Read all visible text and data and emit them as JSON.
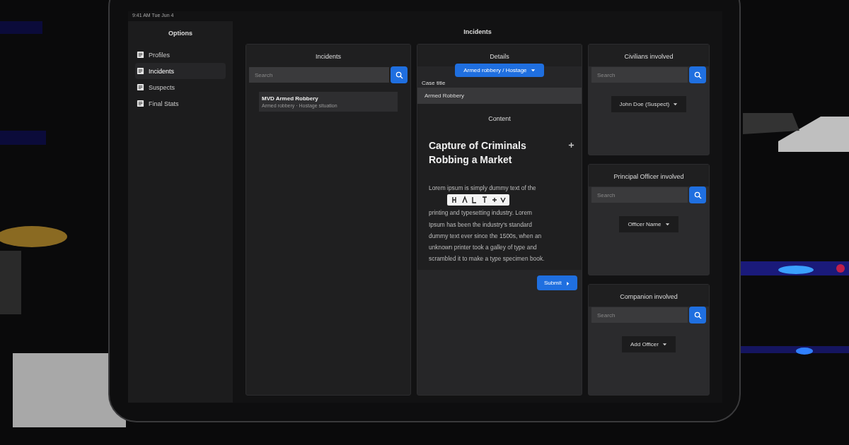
{
  "status_bar": {
    "time": "9:41 AM Tue Jun 4"
  },
  "sidebar": {
    "title": "Options",
    "items": [
      {
        "label": "Profiles",
        "selected": false
      },
      {
        "label": "Incidents",
        "selected": true
      },
      {
        "label": "Suspects",
        "selected": false
      },
      {
        "label": "Final Stats",
        "selected": false
      }
    ]
  },
  "page_title": "Incidents",
  "incidents": {
    "title": "Incidents",
    "search": {
      "placeholder": "Search"
    },
    "items": [
      {
        "title": "MVD Armed Robbery",
        "subtitle": "Armed robbery · Hostage situation",
        "selected": true
      }
    ]
  },
  "details": {
    "title": "Details",
    "category_button": "Armed robbery / Hostage",
    "case_label": "Case title",
    "case_value": "Armed Robbery",
    "content_title": "Content",
    "heading": "Capture of Criminals Robbing a Market",
    "body": [
      "Lorem ipsum is simply dummy text of the",
      "printing and typesetting industry. Lorem Ipsum has been the industry's standard dummy text ever since the 1500s, when an unknown printer took a galley of type and scrambled it to make a type specimen book."
    ],
    "submit": "Submit"
  },
  "involved": [
    {
      "title": "Civilians involved",
      "search": {
        "placeholder": "Search"
      },
      "chip": "John Doe (Suspect)"
    },
    {
      "title": "Principal Officer involved",
      "search": {
        "placeholder": "Search"
      },
      "chip": "Officer Name"
    },
    {
      "title": "Companion involved",
      "search": {
        "placeholder": "Search"
      },
      "chip": "Add Officer"
    }
  ]
}
